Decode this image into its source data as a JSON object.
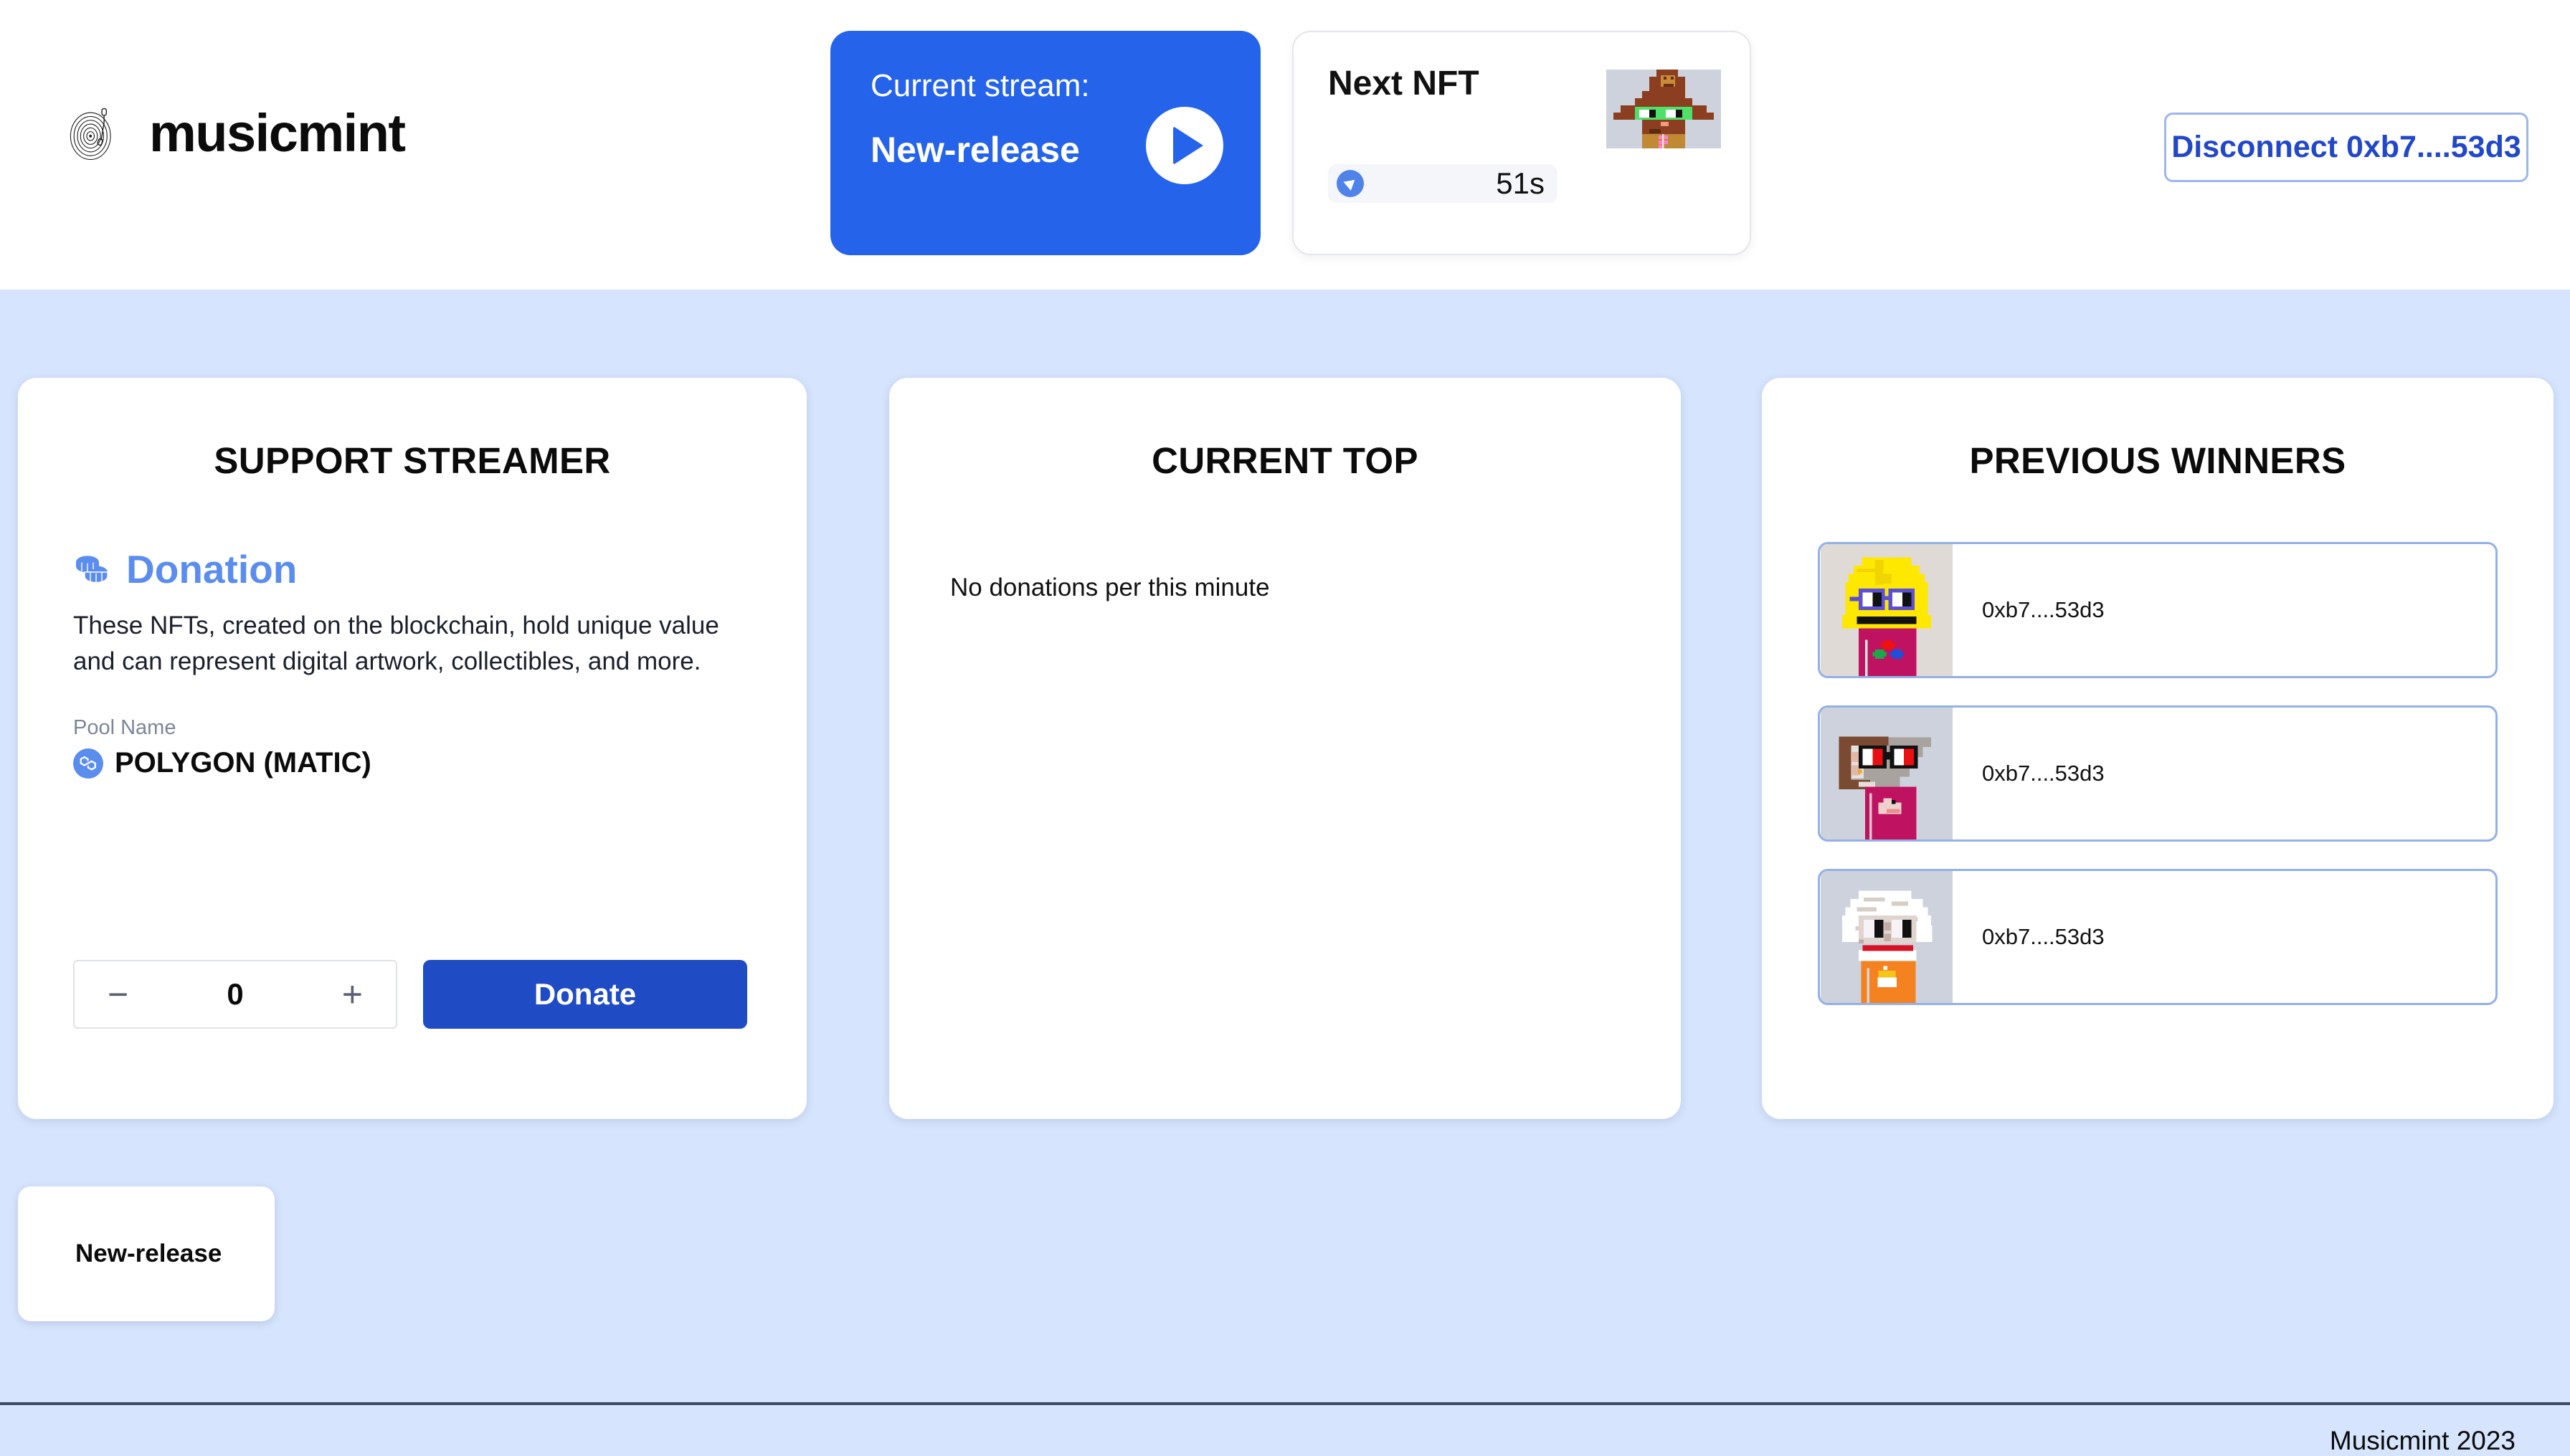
{
  "brand": {
    "name": "musicmint",
    "logo_icon": "vinyl-record-icon"
  },
  "header": {
    "stream_card": {
      "label": "Current stream:",
      "name": "New-release",
      "play_icon": "play-icon"
    },
    "nft_card": {
      "title": "Next NFT",
      "countdown": "51s",
      "timer_icon": "timer-icon",
      "thumb_alt": "next-nft-pixel-avatar"
    },
    "wallet": {
      "disconnect_label": "Disconnect 0xb7....53d3"
    }
  },
  "main": {
    "support": {
      "title": "SUPPORT STREAMER",
      "donation_icon": "coins-icon",
      "donation_heading": "Donation",
      "description": "These NFTs, created on the blockchain, hold unique value and can represent digital artwork, collectibles, and more.",
      "pool_label": "Pool Name",
      "pool_icon": "polygon-icon",
      "pool_name": "POLYGON (MATIC)",
      "stepper": {
        "decrement": "−",
        "value": "0",
        "increment": "+"
      },
      "donate_label": "Donate"
    },
    "current_top": {
      "title": "CURRENT TOP",
      "empty_message": "No donations per this minute"
    },
    "previous_winners": {
      "title": "PREVIOUS WINNERS",
      "rows": [
        {
          "address": "0xb7....53d3",
          "avatar": "winner-avatar-yellow"
        },
        {
          "address": "0xb7....53d3",
          "avatar": "winner-avatar-brown"
        },
        {
          "address": "0xb7....53d3",
          "avatar": "winner-avatar-white"
        }
      ]
    }
  },
  "stream_chip": {
    "label": "New-release"
  },
  "footer": {
    "copyright": "Musicmint 2023"
  },
  "colors": {
    "page_background": "#d6e4fd",
    "header_background": "#ffffff",
    "primary_blue": "#2563eb",
    "donate_blue": "#1f4bc4",
    "accent_blue": "#5b8def",
    "link_blue": "#2247c9",
    "winner_border": "#93b0e8",
    "divider": "#3c4a63"
  }
}
